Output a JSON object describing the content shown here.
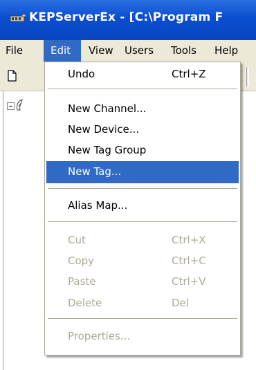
{
  "window": {
    "title": "KEPServerEx - [C:\\Program F"
  },
  "menubar": {
    "items": [
      {
        "label": "File"
      },
      {
        "label": "Edit"
      },
      {
        "label": "View"
      },
      {
        "label": "Users"
      },
      {
        "label": "Tools"
      },
      {
        "label": "Help"
      }
    ]
  },
  "edit_menu": {
    "undo": {
      "label": "Undo",
      "shortcut": "Ctrl+Z"
    },
    "new_channel": {
      "label": "New Channel..."
    },
    "new_device": {
      "label": "New Device..."
    },
    "new_tag_group": {
      "label": "New Tag Group"
    },
    "new_tag": {
      "label": "New Tag..."
    },
    "alias_map": {
      "label": "Alias Map..."
    },
    "cut": {
      "label": "Cut",
      "shortcut": "Ctrl+X"
    },
    "copy": {
      "label": "Copy",
      "shortcut": "Ctrl+C"
    },
    "paste": {
      "label": "Paste",
      "shortcut": "Ctrl+V"
    },
    "delete": {
      "label": "Delete",
      "shortcut": "Del"
    },
    "properties": {
      "label": "Properties..."
    }
  },
  "colors": {
    "titlebar": "#0a4ed0",
    "highlight": "#316ac5",
    "menubar": "#ece9d8",
    "disabled_text": "#aca899"
  },
  "icons": [
    "kepserver-app-icon",
    "new-page-icon",
    "tree-collapse-icon",
    "channel-tree-icon"
  ]
}
